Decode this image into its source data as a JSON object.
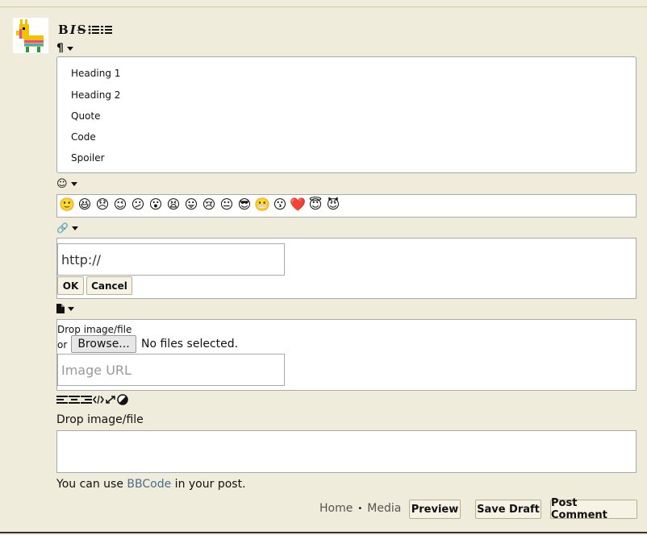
{
  "toolbar": {
    "bold": "B",
    "italic": "I",
    "strike": "S"
  },
  "heading_menu": {
    "items": [
      "Heading 1",
      "Heading 2",
      "Quote",
      "Code",
      "Spoiler"
    ]
  },
  "emojis": [
    "🙂",
    "😆",
    "😞",
    "😉",
    "😕",
    "😮",
    "😫",
    "😛",
    "😢",
    "😐",
    "😎",
    "😬",
    "😗",
    "❤️",
    "😇",
    "😈"
  ],
  "link_dialog": {
    "url_value": "http://",
    "ok_label": "OK",
    "cancel_label": "Cancel"
  },
  "file_dialog": {
    "drop_label": "Drop image/file",
    "or_label": "or",
    "browse_label": "Browse...",
    "no_files_label": "No files selected.",
    "image_url_placeholder": "Image URL"
  },
  "editor": {
    "drop_label": "Drop image/file",
    "hint_prefix": "You can use ",
    "hint_link": "BBCode",
    "hint_suffix": " in your post."
  },
  "footer": {
    "home_link": "Home",
    "separator": "•",
    "media_link": "Media",
    "preview_label": "Preview",
    "save_draft_label": "Save Draft",
    "post_comment_label": "Post Comment"
  },
  "icons": {
    "paragraph": "paragraph-icon",
    "smiley": "smiley-icon",
    "link": "link-icon",
    "file": "file-icon",
    "align": "align-icons"
  }
}
